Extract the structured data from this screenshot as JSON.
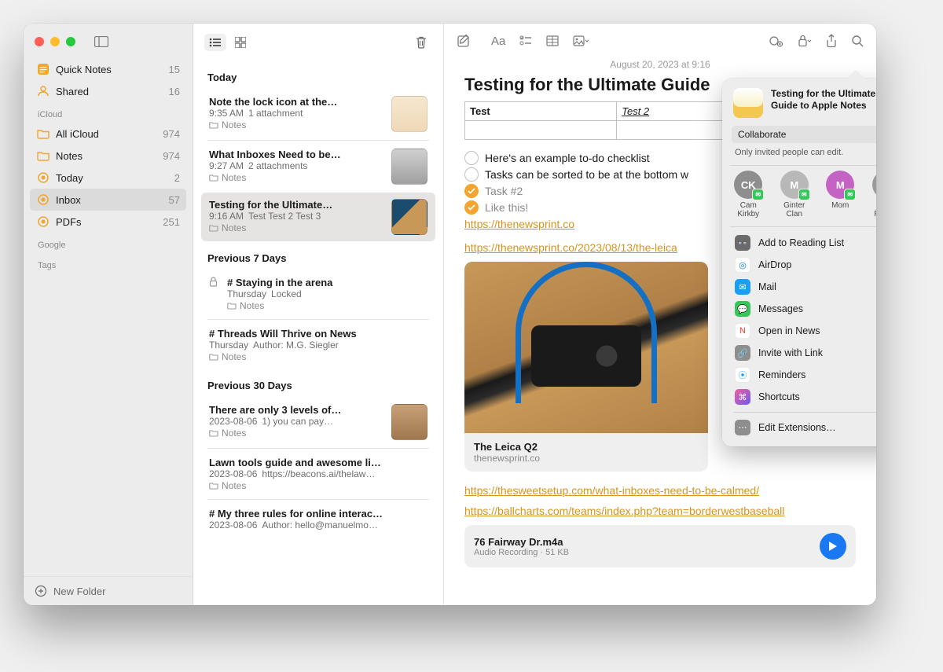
{
  "sidebar": {
    "quick_notes": {
      "label": "Quick Notes",
      "count": 15
    },
    "shared": {
      "label": "Shared",
      "count": 16
    },
    "section_icloud": "iCloud",
    "all_icloud": {
      "label": "All iCloud",
      "count": 974
    },
    "notes": {
      "label": "Notes",
      "count": 974
    },
    "today": {
      "label": "Today",
      "count": 2
    },
    "inbox": {
      "label": "Inbox",
      "count": 57
    },
    "pdfs": {
      "label": "PDFs",
      "count": 251
    },
    "section_google": "Google",
    "section_tags": "Tags",
    "new_folder": "New Folder"
  },
  "list": {
    "group_today": "Today",
    "group_prev7": "Previous 7 Days",
    "group_prev30": "Previous 30 Days",
    "items": [
      {
        "title": "Note the lock icon at the…",
        "time": "9:35 AM",
        "meta": "1 attachment",
        "folder": "Notes"
      },
      {
        "title": "What Inboxes Need to be…",
        "time": "9:27 AM",
        "meta": "2 attachments",
        "folder": "Notes"
      },
      {
        "title": "Testing for the Ultimate…",
        "time": "9:16 AM",
        "meta": "Test Test 2 Test 3",
        "folder": "Notes"
      },
      {
        "title": "# Staying in the arena",
        "time": "Thursday",
        "meta": "Locked",
        "folder": "Notes"
      },
      {
        "title": "# Threads Will Thrive on News",
        "time": "Thursday",
        "meta": "Author: M.G. Siegler",
        "folder": "Notes"
      },
      {
        "title": "There are only 3 levels of…",
        "time": "2023-08-06",
        "meta": "1) you can pay…",
        "folder": "Notes"
      },
      {
        "title": "Lawn tools guide and awesome li…",
        "time": "2023-08-06",
        "meta": "https://beacons.ai/thelaw…",
        "folder": "Notes"
      },
      {
        "title": "# My three rules for online interac…",
        "time": "2023-08-06",
        "meta": "Author: hello@manuelmo…",
        "folder": ""
      }
    ]
  },
  "editor": {
    "date": "August 20, 2023 at 9:16",
    "title": "Testing for the Ultimate Guide",
    "table": {
      "c1": "Test",
      "c2": "Test 2"
    },
    "checks": [
      {
        "done": false,
        "text": "Here's an example to-do checklist"
      },
      {
        "done": false,
        "text": "Tasks can be sorted to be at the bottom w"
      },
      {
        "done": true,
        "text": "Task #2"
      },
      {
        "done": true,
        "text": "Like this!"
      }
    ],
    "link1": "https://thenewsprint.co",
    "link2": "https://thenewsprint.co/2023/08/13/the-leica",
    "preview": {
      "title": "The Leica Q2",
      "url": "thenewsprint.co"
    },
    "link3": "https://thesweetsetup.com/what-inboxes-need-to-be-calmed/",
    "link4": "https://ballcharts.com/teams/index.php?team=borderwestbaseball",
    "audio": {
      "title": "76 Fairway Dr.m4a",
      "sub": "Audio Recording · 51 KB"
    }
  },
  "share": {
    "title": "Testing for the Ultimate Guide to Apple Notes",
    "mode": "Collaborate",
    "permission": "Only invited people can edit.",
    "people": [
      {
        "initials": "CK",
        "name": "Cam Kirkby",
        "color": "#8e8e8e"
      },
      {
        "initials": "M",
        "name": "Ginter Clan",
        "color": "#b8b8b8"
      },
      {
        "initials": "M",
        "name": "Mom",
        "color": "#c463c4"
      },
      {
        "initials": "JF",
        "name": "John Froese",
        "color": "#9a9a9a"
      }
    ],
    "menu": [
      {
        "label": "Add to Reading List",
        "bg": "#6a6a6a",
        "glyph": "👓"
      },
      {
        "label": "AirDrop",
        "bg": "#ffffff",
        "glyph": "◎",
        "fg": "#0a7aff"
      },
      {
        "label": "Mail",
        "bg": "#1a9ff5",
        "glyph": "✉"
      },
      {
        "label": "Messages",
        "bg": "#34c759",
        "glyph": "💬"
      },
      {
        "label": "Open in News",
        "bg": "#ffffff",
        "glyph": "N",
        "fg": "#ff3b30"
      },
      {
        "label": "Invite with Link",
        "bg": "#8e8e8e",
        "glyph": "🔗"
      },
      {
        "label": "Reminders",
        "bg": "#ffffff",
        "glyph": "⦿",
        "fg": "#1a9ff5"
      },
      {
        "label": "Shortcuts",
        "bg": "linear-gradient(135deg,#f25c9c,#6a5cf2)",
        "glyph": "⌘"
      }
    ],
    "edit_ext": "Edit Extensions…"
  }
}
